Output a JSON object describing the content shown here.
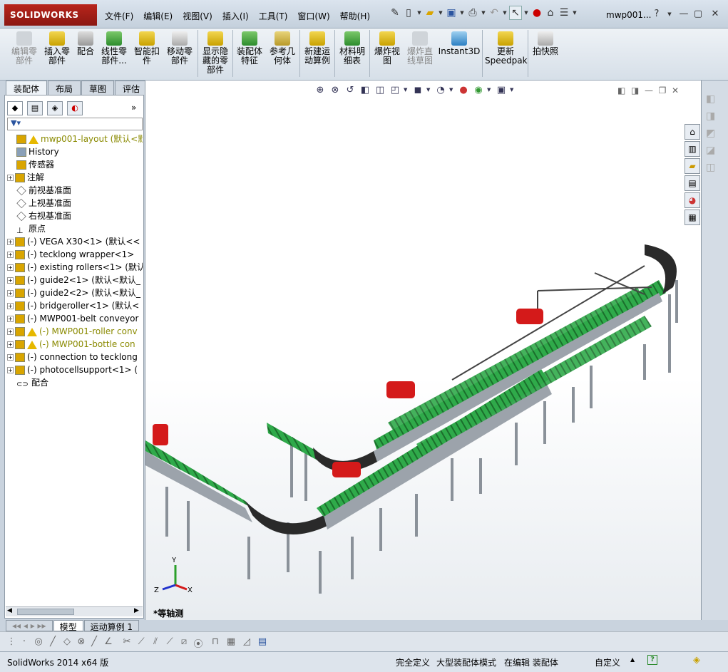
{
  "app": {
    "logo": "SOLIDWORKS",
    "doc_title": "mwp001..."
  },
  "menu": [
    "文件(F)",
    "编辑(E)",
    "视图(V)",
    "插入(I)",
    "工具(T)",
    "窗口(W)",
    "帮助(H)"
  ],
  "ribbon": {
    "edit_component": "编辑零\n部件",
    "insert_component": "插入零\n部件",
    "mate": "配合",
    "linear_pattern": "线性零\n部件...",
    "smart_fasteners": "智能扣\n件",
    "move_component": "移动零\n部件",
    "show_hidden": "显示隐\n藏的零\n部件",
    "assembly_features": "装配体\n特征",
    "reference_geometry": "参考几\n何体",
    "new_motion_study": "新建运\n动算例",
    "bom": "材料明\n细表",
    "exploded_view": "爆炸视\n图",
    "explode_line": "爆炸直\n线草图",
    "instant3d": "Instant3D",
    "update_speedpak": "更新\nSpeedpak",
    "snapshot": "拍快照"
  },
  "cm_tabs": [
    "装配体",
    "布局",
    "草图",
    "评估"
  ],
  "tree": [
    {
      "label": "mwp001-layout  (默认<默认",
      "icon": "asm",
      "warn": true,
      "olive": true,
      "exp": false,
      "indent": 0
    },
    {
      "label": "History",
      "icon": "history",
      "exp": false,
      "indent": 1
    },
    {
      "label": "传感器",
      "icon": "sensor",
      "exp": false,
      "indent": 1
    },
    {
      "label": "注解",
      "icon": "annot",
      "exp": true,
      "indent": 1
    },
    {
      "label": "前视基准面",
      "icon": "plane",
      "exp": false,
      "indent": 1
    },
    {
      "label": "上视基准面",
      "icon": "plane",
      "exp": false,
      "indent": 1
    },
    {
      "label": "右视基准面",
      "icon": "plane",
      "exp": false,
      "indent": 1
    },
    {
      "label": "原点",
      "icon": "origin",
      "exp": false,
      "indent": 1
    },
    {
      "label": "(-) VEGA X30<1> (默认<<",
      "icon": "part",
      "exp": true,
      "indent": 1
    },
    {
      "label": "(-) tecklong wrapper<1>",
      "icon": "part",
      "exp": true,
      "indent": 1
    },
    {
      "label": "(-) existing rollers<1> (默认",
      "icon": "part",
      "exp": true,
      "indent": 1
    },
    {
      "label": "(-) guide2<1> (默认<默认_",
      "icon": "part",
      "exp": true,
      "indent": 1
    },
    {
      "label": "(-) guide2<2> (默认<默认_",
      "icon": "part",
      "exp": true,
      "indent": 1
    },
    {
      "label": "(-) bridgeroller<1> (默认<",
      "icon": "part",
      "exp": true,
      "indent": 1
    },
    {
      "label": "(-) MWP001-belt conveyor",
      "icon": "part",
      "exp": true,
      "indent": 1
    },
    {
      "label": "(-) MWP001-roller conv",
      "icon": "part",
      "warn": true,
      "olive": true,
      "exp": true,
      "indent": 1
    },
    {
      "label": "(-) MWP001-bottle con",
      "icon": "part",
      "warn": true,
      "olive": true,
      "exp": true,
      "indent": 1
    },
    {
      "label": "(-) connection to tecklong",
      "icon": "part",
      "exp": true,
      "indent": 1
    },
    {
      "label": "(-) photocellsupport<1> (",
      "icon": "part",
      "exp": true,
      "indent": 1
    },
    {
      "label": "配合",
      "icon": "mate",
      "exp": false,
      "indent": 1
    }
  ],
  "bottom_tabs": [
    "模型",
    "运动算例 1"
  ],
  "view_name": "*等轴测",
  "status": {
    "version": "SolidWorks 2014 x64 版",
    "fully_defined": "完全定义",
    "large_asm": "大型装配体模式",
    "editing": "在编辑 装配体",
    "custom": "自定义"
  },
  "axis_labels": {
    "x": "X",
    "y": "Y",
    "z": "Z"
  },
  "colors": {
    "conveyor_green": "#2faa4a",
    "frame_grey": "#9ca3ab",
    "motor_red": "#d41a1a",
    "belt_black": "#2a2a2a"
  }
}
